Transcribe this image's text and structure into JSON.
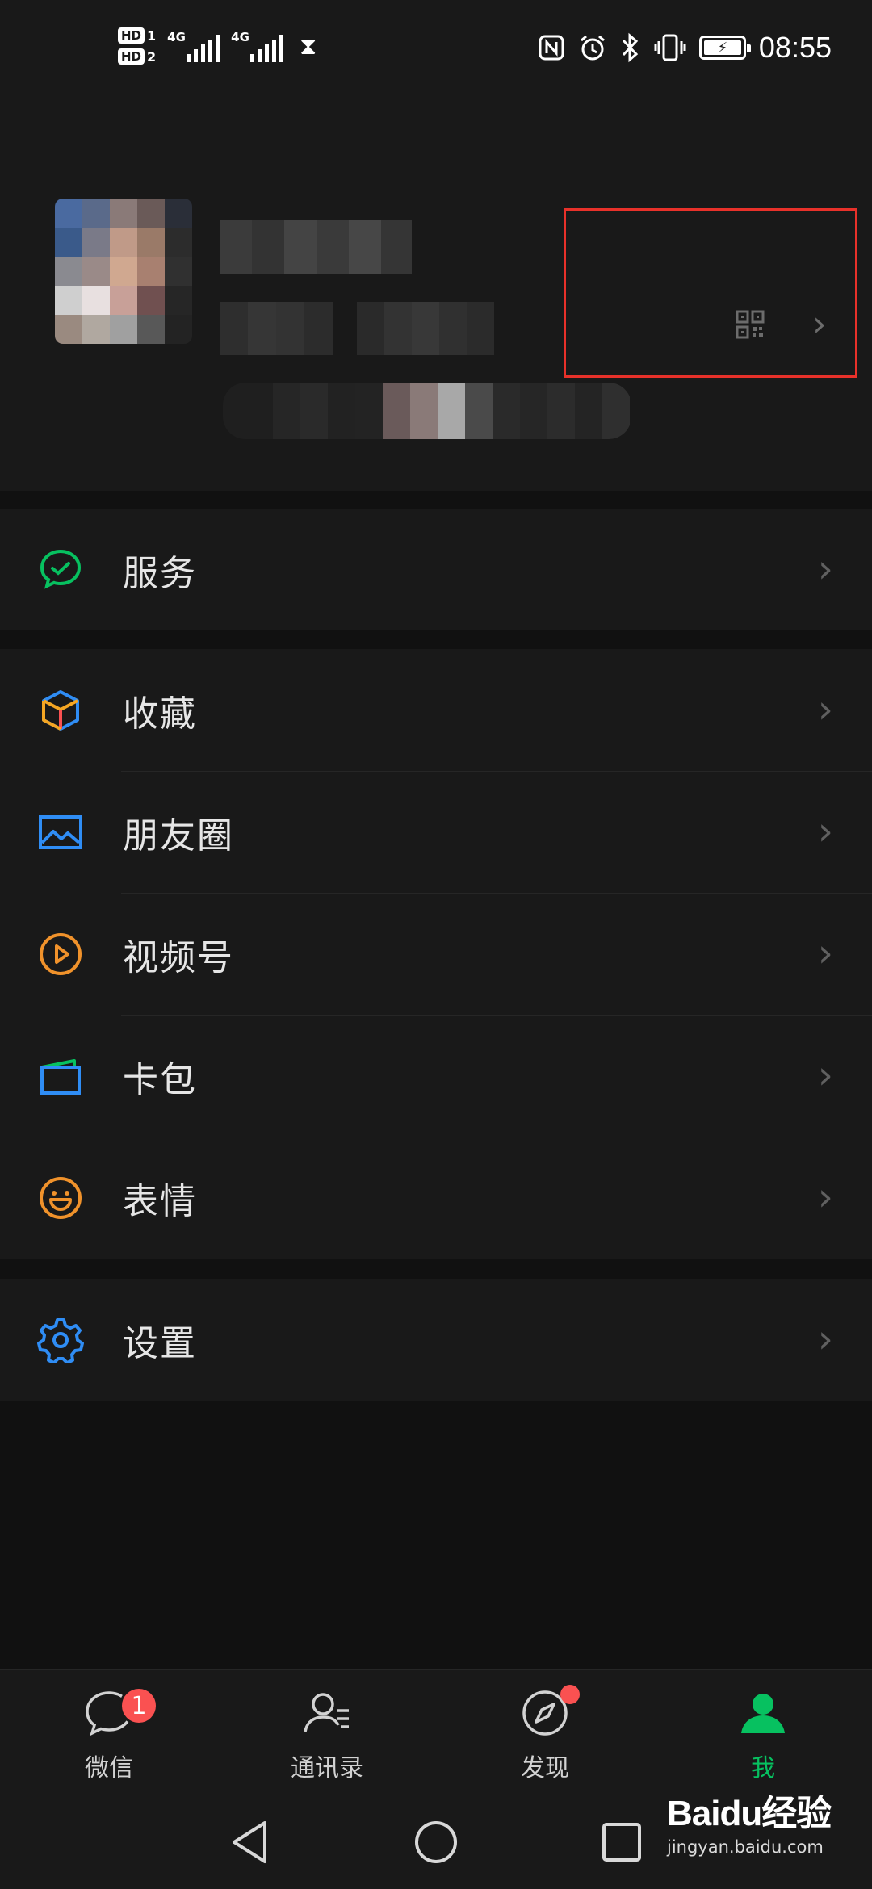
{
  "status_bar": {
    "sim1_badge": "HD",
    "sim1_num": "1",
    "sim2_badge": "HD",
    "sim2_num": "2",
    "net1": "4G",
    "net2": "4G",
    "time": "08:55",
    "icons": [
      "nfc-icon",
      "alarm-icon",
      "bluetooth-icon",
      "vibrate-icon",
      "battery-charging-icon",
      "hourglass-icon"
    ]
  },
  "profile": {
    "avatar": "blurred-avatar",
    "name": "",
    "wechat_id": "",
    "status": "",
    "qr_icon": "qr-code-icon",
    "highlight_color": "#e8312a"
  },
  "groups": [
    [
      {
        "label": "服务",
        "icon": "services-icon",
        "color": "#07c160"
      }
    ],
    [
      {
        "label": "收藏",
        "icon": "favorites-icon",
        "color": "#f5a623"
      },
      {
        "label": "朋友圈",
        "icon": "moments-icon",
        "color": "#2f8df5"
      },
      {
        "label": "视频号",
        "icon": "channels-icon",
        "color": "#f0922b"
      },
      {
        "label": "卡包",
        "icon": "card-wallet-icon",
        "color": "#2f8df5"
      },
      {
        "label": "表情",
        "icon": "sticker-icon",
        "color": "#f0922b"
      }
    ],
    [
      {
        "label": "设置",
        "icon": "settings-icon",
        "color": "#2f8df5"
      }
    ]
  ],
  "tabbar": {
    "tabs": [
      {
        "label": "微信",
        "icon": "chat-icon",
        "badge": "1"
      },
      {
        "label": "通讯录",
        "icon": "contacts-icon"
      },
      {
        "label": "发现",
        "icon": "discover-icon",
        "dot": true
      },
      {
        "label": "我",
        "icon": "me-icon",
        "active": true
      }
    ],
    "active_color": "#07c160"
  },
  "watermark": {
    "logo": "Baidu经验",
    "url": "jingyan.baidu.com"
  }
}
